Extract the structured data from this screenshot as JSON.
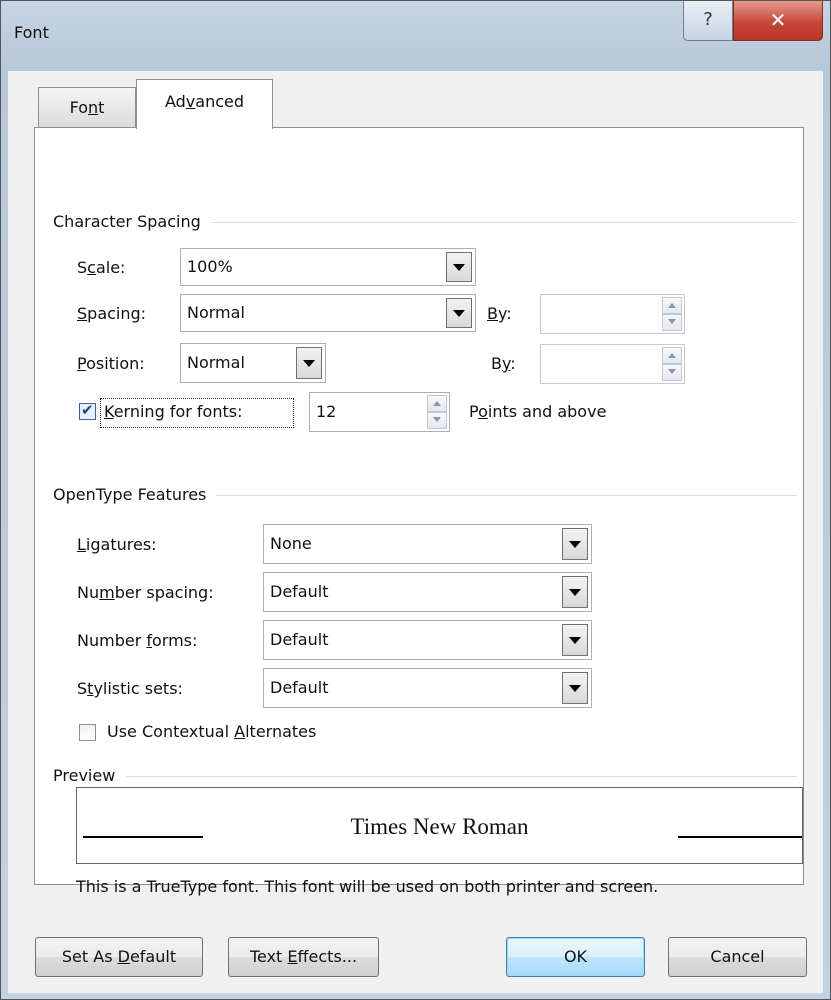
{
  "window": {
    "title": "Font",
    "help_glyph": "?",
    "close_glyph": "✕"
  },
  "tabs": [
    {
      "pre": "Fo",
      "u": "n",
      "post": "t"
    },
    {
      "pre": "Ad",
      "u": "v",
      "post": "anced"
    }
  ],
  "character_spacing": {
    "heading": "Character Spacing",
    "scale": {
      "pre": "S",
      "u": "c",
      "post": "ale:",
      "value": "100%"
    },
    "spacing": {
      "pre": "",
      "u": "S",
      "post": "pacing:",
      "value": "Normal"
    },
    "spacing_by": {
      "pre": "",
      "u": "B",
      "post": "y:",
      "value": ""
    },
    "position": {
      "pre": "",
      "u": "P",
      "post": "osition:",
      "value": "Normal"
    },
    "position_by": {
      "pre": "B",
      "u": "y",
      "post": ":",
      "value": ""
    },
    "kerning": {
      "pre": "",
      "u": "K",
      "post": "erning for fonts:",
      "value": "12",
      "checked": true
    },
    "kerning_suffix": {
      "pre": "P",
      "u": "o",
      "post": "ints and above"
    }
  },
  "opentype": {
    "heading": "OpenType Features",
    "ligatures": {
      "pre": "",
      "u": "L",
      "post": "igatures:",
      "value": "None"
    },
    "number_spacing": {
      "pre": "Nu",
      "u": "m",
      "post": "ber spacing:",
      "value": "Default"
    },
    "number_forms": {
      "pre": "Number ",
      "u": "f",
      "post": "orms:",
      "value": "Default"
    },
    "stylistic_sets": {
      "pre": "S",
      "u": "t",
      "post": "ylistic sets:",
      "value": "Default"
    },
    "contextual": {
      "pre": "Use Contextual ",
      "u": "A",
      "post": "lternates",
      "checked": false
    }
  },
  "preview": {
    "heading": "Preview",
    "sample": "Times New Roman",
    "note": "This is a TrueType font. This font will be used on both printer and screen."
  },
  "buttons": {
    "set_default": {
      "pre": "Set As ",
      "u": "D",
      "post": "efault"
    },
    "text_effects": {
      "pre": "Text ",
      "u": "E",
      "post": "ffects..."
    },
    "ok": {
      "pre": "OK",
      "u": "",
      "post": ""
    },
    "cancel": {
      "pre": "Cancel",
      "u": "",
      "post": ""
    }
  },
  "colors": {
    "title_bar": "#c7d5e4",
    "close_button": "#c6463a",
    "ok_button": "#bee6fd"
  }
}
